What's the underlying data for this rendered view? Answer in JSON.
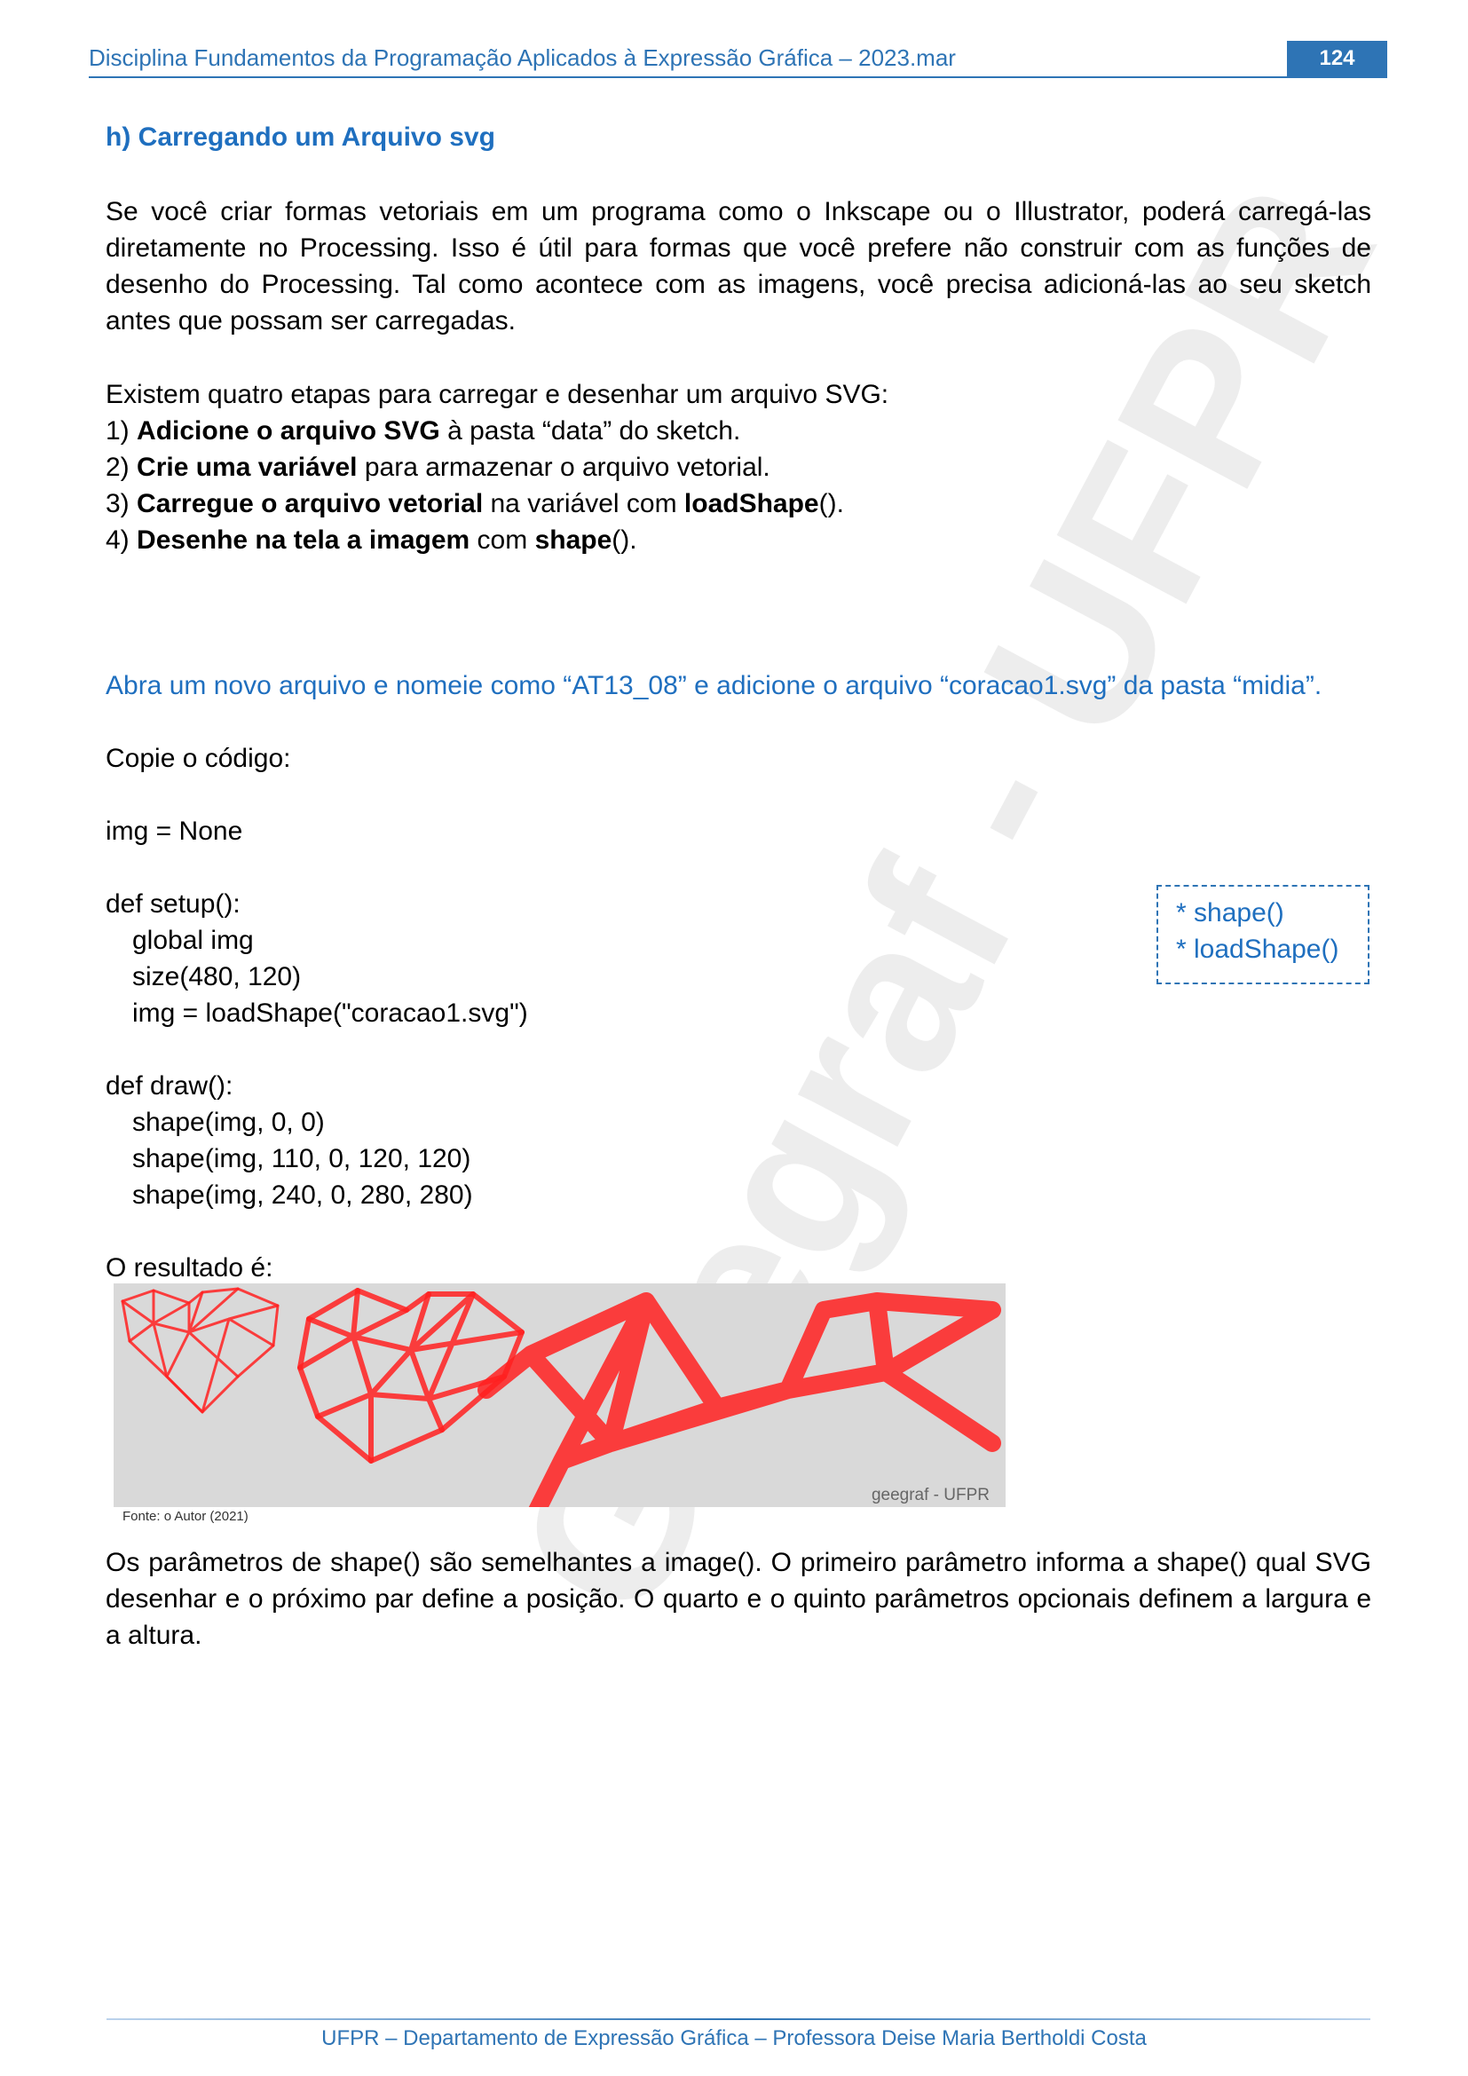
{
  "header": {
    "title": "Disciplina Fundamentos da Programação Aplicados à Expressão Gráfica – 2023.mar",
    "page_number": "124"
  },
  "watermark": "Geegraf - UFPR",
  "section": {
    "heading": "h) Carregando um Arquivo svg",
    "intro": "Se você criar formas vetoriais em um programa como o Inkscape ou o Illustrator, poderá carregá-las diretamente no Processing. Isso é útil para formas que você prefere não construir com as funções de desenho do Processing. Tal como acontece com as imagens, você precisa adicioná-las ao seu sketch antes que possam ser carregadas.",
    "steps_intro": "Existem quatro etapas para carregar e desenhar um arquivo SVG:",
    "steps": [
      {
        "num": "1)",
        "bold": "Adicione o arquivo SVG",
        "rest": " à pasta “data” do sketch.",
        "bold2": "",
        "rest2": ""
      },
      {
        "num": "2)",
        "bold": "Crie uma variável",
        "rest": " para armazenar o arquivo vetorial.",
        "bold2": "",
        "rest2": ""
      },
      {
        "num": "3)",
        "bold": "Carregue o arquivo vetorial",
        "rest": " na variável com ",
        "bold2": "loadShape",
        "rest2": "()."
      },
      {
        "num": "4)",
        "bold": "Desenhe na tela a imagem",
        "rest": " com ",
        "bold2": "shape",
        "rest2": "()."
      }
    ],
    "instruction": "Abra um novo arquivo e nomeie como “AT13_08” e adicione o arquivo “coracao1.svg” da pasta “midia”.",
    "copy_label": "Copie o código:",
    "code": [
      "img = None",
      "def setup():",
      "global img",
      "size(480, 120)",
      "img = loadShape(\"coracao1.svg\")",
      "def draw():",
      "shape(img, 0, 0)",
      "shape(img, 110, 0, 120, 120)",
      "shape(img, 240, 0, 280, 280)"
    ],
    "note_items": [
      "* shape()",
      "* loadShape()"
    ],
    "result_label": "O resultado é:",
    "figure_watermark": "geegraf - UFPR",
    "caption": "Fonte: o Autor (2021)",
    "explanation": "Os parâmetros de shape() são semelhantes a image(). O primeiro parâmetro informa a shape() qual SVG desenhar e o próximo par define a posição. O quarto e o quinto parâmetros opcionais definem a largura e a altura."
  },
  "footer": "UFPR – Departamento de Expressão Gráfica – Professora Deise Maria Bertholdi Costa",
  "colors": {
    "accent": "#2e74b5",
    "heading_blue": "#1f6fbf",
    "heart_red": "#ff2020",
    "figure_bg": "#d9d9d9"
  }
}
